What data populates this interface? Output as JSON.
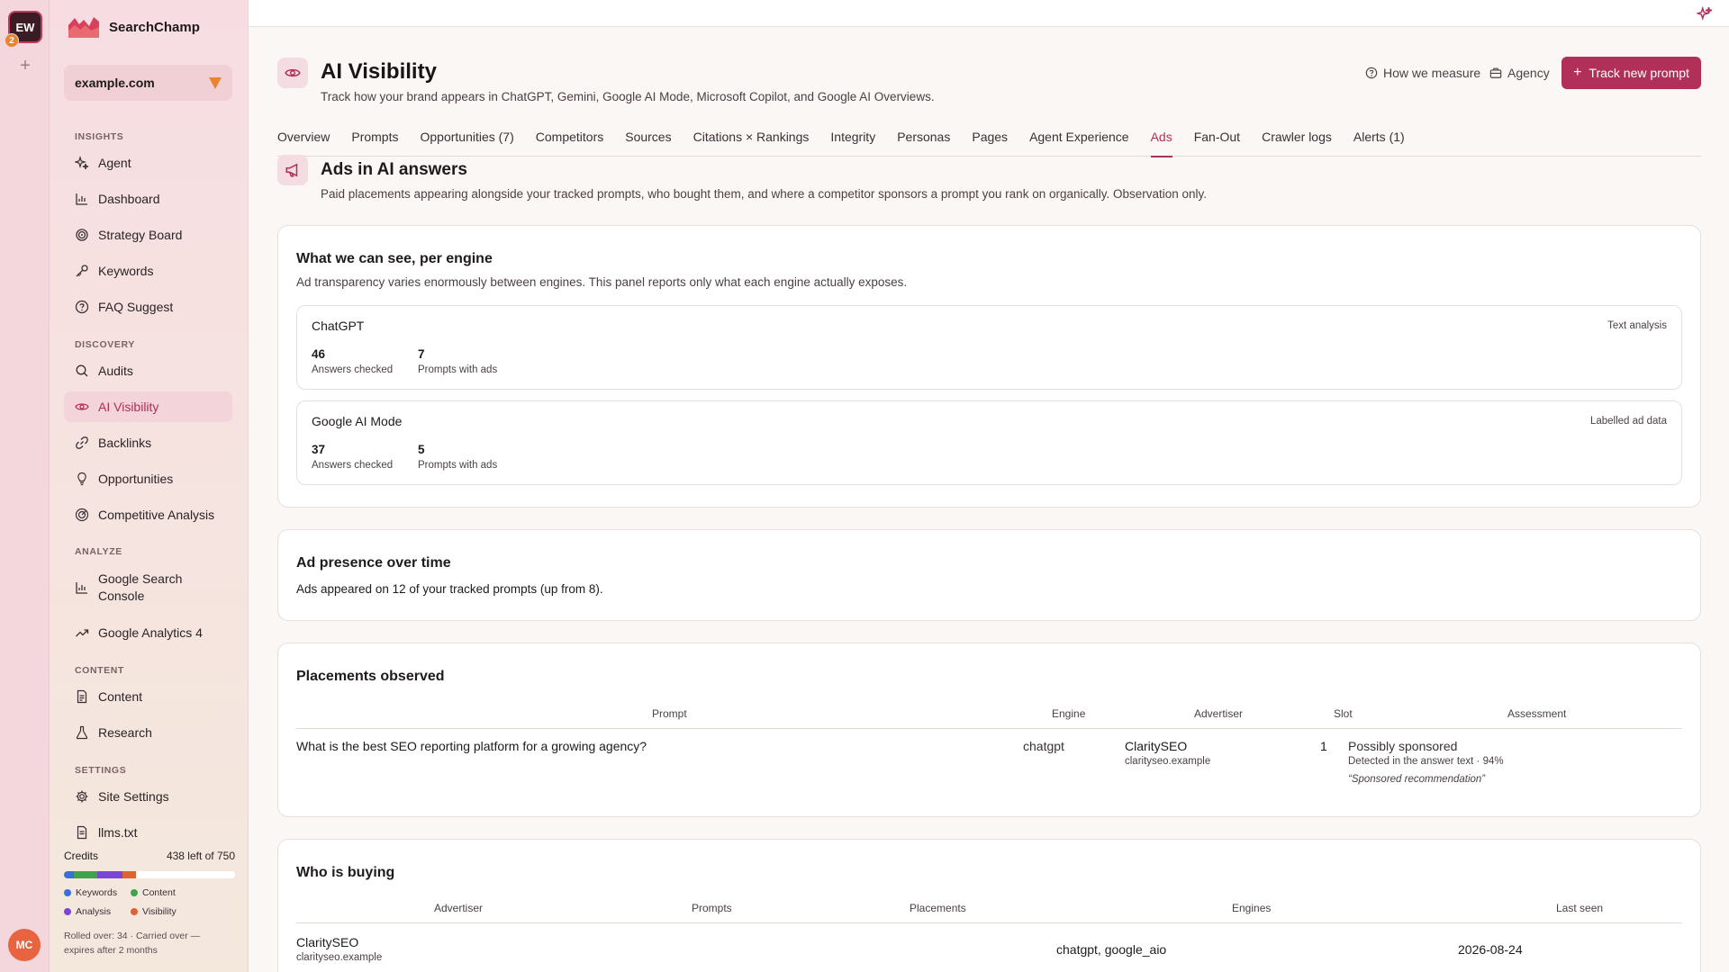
{
  "workspace": {
    "initials": "EW",
    "notification_count": "2",
    "add_symbol": "+",
    "user_initials": "MC"
  },
  "brand": {
    "name": "SearchChamp"
  },
  "site_selector": {
    "value": "example.com"
  },
  "sidebar": {
    "sections": {
      "insights": "INSIGHTS",
      "discovery": "DISCOVERY",
      "analyze": "ANALYZE",
      "content": "CONTENT",
      "settings": "SETTINGS"
    },
    "items": {
      "agent": "Agent",
      "dashboard": "Dashboard",
      "strategy_board": "Strategy Board",
      "keywords": "Keywords",
      "faq_suggest": "FAQ Suggest",
      "audits": "Audits",
      "ai_visibility": "AI Visibility",
      "backlinks": "Backlinks",
      "opportunities": "Opportunities",
      "competitive_analysis": "Competitive Analysis",
      "gsc_line1": "Google Search",
      "gsc_line2": "Console",
      "ga4": "Google Analytics 4",
      "content": "Content",
      "research": "Research",
      "site_settings": "Site Settings",
      "llms": "llms.txt"
    }
  },
  "credits": {
    "label": "Credits",
    "remaining": "438 left of 750",
    "segments": [
      {
        "name": "Keywords",
        "color": "#3b6fd8",
        "fraction": 0.06
      },
      {
        "name": "Content",
        "color": "#3fa34d",
        "fraction": 0.135
      },
      {
        "name": "Analysis",
        "color": "#7b46d6",
        "fraction": 0.145
      },
      {
        "name": "Visibility",
        "color": "#e0622f",
        "fraction": 0.08
      }
    ],
    "legend": {
      "keywords": "Keywords",
      "content": "Content",
      "analysis": "Analysis",
      "visibility": "Visibility"
    },
    "rolled_line1": "Rolled over: 34 · Carried over —",
    "rolled_line2": "expires after 2 months"
  },
  "header": {
    "title": "AI Visibility",
    "subtitle": "Track how your brand appears in ChatGPT, Gemini, Google AI Mode, Microsoft Copilot, and Google AI Overviews.",
    "how_we_measure": "How we measure",
    "agency": "Agency",
    "track_button": "Track new prompt"
  },
  "tabs": [
    "Overview",
    "Prompts",
    "Opportunities (7)",
    "Competitors",
    "Sources",
    "Citations × Rankings",
    "Integrity",
    "Personas",
    "Pages",
    "Agent Experience",
    "Ads",
    "Fan-Out",
    "Crawler logs",
    "Alerts (1)"
  ],
  "active_tab": "Ads",
  "section": {
    "title": "Ads in AI answers",
    "subtitle": "Paid placements appearing alongside your tracked prompts, who bought them, and where a competitor sponsors a prompt you rank on organically. Observation only."
  },
  "engines_card": {
    "title": "What we can see, per engine",
    "subtitle": "Ad transparency varies enormously between engines. This panel reports only what each engine actually exposes.",
    "engines": [
      {
        "name": "ChatGPT",
        "tag": "Text analysis",
        "answers_checked": "46",
        "answers_label": "Answers checked",
        "prompts_with_ads": "7",
        "prompts_label": "Prompts with ads"
      },
      {
        "name": "Google AI Mode",
        "tag": "Labelled ad data",
        "answers_checked": "37",
        "answers_label": "Answers checked",
        "prompts_with_ads": "5",
        "prompts_label": "Prompts with ads"
      }
    ]
  },
  "presence_card": {
    "title": "Ad presence over time",
    "text": "Ads appeared on 12 of your tracked prompts (up from 8)."
  },
  "placements_card": {
    "title": "Placements observed",
    "columns": {
      "prompt": "Prompt",
      "engine": "Engine",
      "advertiser": "Advertiser",
      "slot": "Slot",
      "assessment": "Assessment"
    },
    "rows": [
      {
        "prompt": "What is the best SEO reporting platform for a growing agency?",
        "engine": "chatgpt",
        "advertiser": "ClaritySEO",
        "advertiser_domain": "clarityseo.example",
        "slot": "1",
        "assessment": "Possibly sponsored",
        "detail": "Detected in the answer text · 94%",
        "quote": "“Sponsored recommendation”"
      }
    ]
  },
  "buyers_card": {
    "title": "Who is buying",
    "columns": {
      "advertiser": "Advertiser",
      "prompts": "Prompts",
      "placements": "Placements",
      "engines": "Engines",
      "last_seen": "Last seen"
    },
    "rows": [
      {
        "advertiser": "ClaritySEO",
        "domain": "clarityseo.example",
        "engines": "chatgpt, google_aio",
        "last_seen": "2026-08-24"
      }
    ]
  }
}
